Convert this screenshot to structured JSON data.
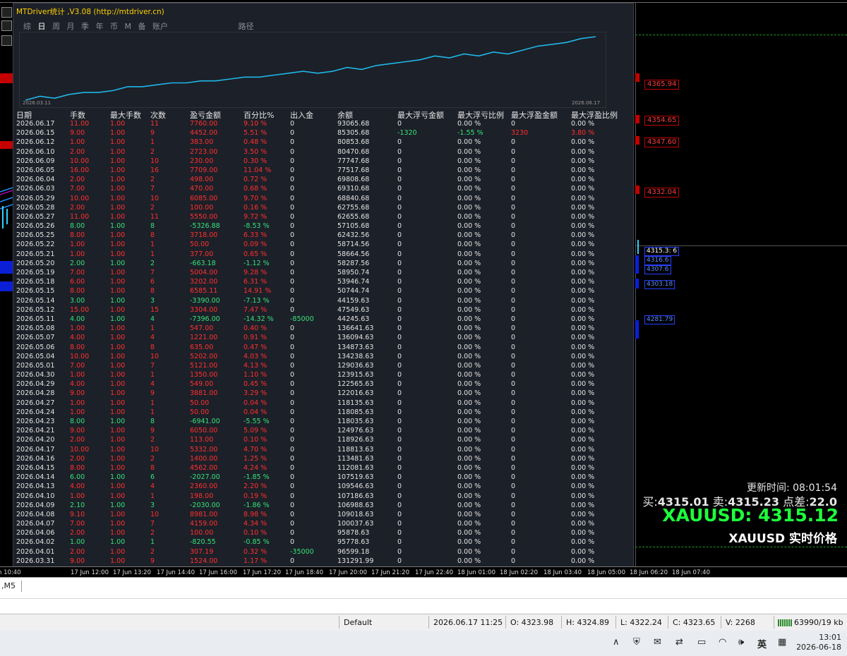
{
  "panel": {
    "title": "MTDriver统计 ,V3.08 (http://mtdriver.cn)",
    "menu": [
      "综",
      "日",
      "周",
      "月",
      "季",
      "年",
      "币",
      "M",
      "备",
      "账户",
      "路径"
    ],
    "curve_start": "2026.03.11",
    "curve_end": "2026.06.17",
    "headers": [
      "日期",
      "手数",
      "最大手数",
      "次数",
      "盈亏金额",
      "百分比%",
      "出入金",
      "余额",
      "最大浮亏金额",
      "最大浮亏比例",
      "最大浮盈金额",
      "最大浮盈比例"
    ],
    "rows": [
      [
        "2026.06.17",
        "11.00",
        "1.00",
        "11",
        "7760.00",
        "9.10 %",
        "0",
        "93065.68",
        "0",
        "0.00 %",
        "0",
        "0.00 %"
      ],
      [
        "2026.06.15",
        "9.00",
        "1.00",
        "9",
        "4452.00",
        "5.51 %",
        "0",
        "85305.68",
        "-1320",
        "-1.55 %",
        "3230",
        "3.80 %"
      ],
      [
        "2026.06.12",
        "1.00",
        "1.00",
        "1",
        "383.00",
        "0.48 %",
        "0",
        "80853.68",
        "0",
        "0.00 %",
        "0",
        "0.00 %"
      ],
      [
        "2026.06.10",
        "2.00",
        "1.00",
        "2",
        "2723.00",
        "3.50 %",
        "0",
        "80470.68",
        "0",
        "0.00 %",
        "0",
        "0.00 %"
      ],
      [
        "2026.06.09",
        "10.00",
        "1.00",
        "10",
        "230.00",
        "0.30 %",
        "0",
        "77747.68",
        "0",
        "0.00 %",
        "0",
        "0.00 %"
      ],
      [
        "2026.06.05",
        "16.00",
        "1.00",
        "16",
        "7709.00",
        "11.04 %",
        "0",
        "77517.68",
        "0",
        "0.00 %",
        "0",
        "0.00 %"
      ],
      [
        "2026.06.04",
        "2.00",
        "1.00",
        "2",
        "498.00",
        "0.72 %",
        "0",
        "69808.68",
        "0",
        "0.00 %",
        "0",
        "0.00 %"
      ],
      [
        "2026.06.03",
        "7.00",
        "1.00",
        "7",
        "470.00",
        "0.68 %",
        "0",
        "69310.68",
        "0",
        "0.00 %",
        "0",
        "0.00 %"
      ],
      [
        "2026.05.29",
        "10.00",
        "1.00",
        "10",
        "6085.00",
        "9.70 %",
        "0",
        "68840.68",
        "0",
        "0.00 %",
        "0",
        "0.00 %"
      ],
      [
        "2026.05.28",
        "2.00",
        "1.00",
        "2",
        "100.00",
        "0.16 %",
        "0",
        "62755.68",
        "0",
        "0.00 %",
        "0",
        "0.00 %"
      ],
      [
        "2026.05.27",
        "11.00",
        "1.00",
        "11",
        "5550.00",
        "9.72 %",
        "0",
        "62655.68",
        "0",
        "0.00 %",
        "0",
        "0.00 %"
      ],
      [
        "2026.05.26",
        "8.00",
        "1.00",
        "8",
        "-5326.88",
        "-8.53 %",
        "0",
        "57105.68",
        "0",
        "0.00 %",
        "0",
        "0.00 %"
      ],
      [
        "2026.05.25",
        "8.00",
        "1.00",
        "8",
        "3718.00",
        "6.33 %",
        "0",
        "62432.56",
        "0",
        "0.00 %",
        "0",
        "0.00 %"
      ],
      [
        "2026.05.22",
        "1.00",
        "1.00",
        "1",
        "50.00",
        "0.09 %",
        "0",
        "58714.56",
        "0",
        "0.00 %",
        "0",
        "0.00 %"
      ],
      [
        "2026.05.21",
        "1.00",
        "1.00",
        "1",
        "377.00",
        "0.65 %",
        "0",
        "58664.56",
        "0",
        "0.00 %",
        "0",
        "0.00 %"
      ],
      [
        "2026.05.20",
        "2.00",
        "1.00",
        "2",
        "-663.18",
        "-1.12 %",
        "0",
        "58287.56",
        "0",
        "0.00 %",
        "0",
        "0.00 %"
      ],
      [
        "2026.05.19",
        "7.00",
        "1.00",
        "7",
        "5004.00",
        "9.28 %",
        "0",
        "58950.74",
        "0",
        "0.00 %",
        "0",
        "0.00 %"
      ],
      [
        "2026.05.18",
        "6.00",
        "1.00",
        "6",
        "3202.00",
        "6.31 %",
        "0",
        "53946.74",
        "0",
        "0.00 %",
        "0",
        "0.00 %"
      ],
      [
        "2026.05.15",
        "8.00",
        "1.00",
        "8",
        "6585.11",
        "14.91 %",
        "0",
        "50744.74",
        "0",
        "0.00 %",
        "0",
        "0.00 %"
      ],
      [
        "2026.05.14",
        "3.00",
        "1.00",
        "3",
        "-3390.00",
        "-7.13 %",
        "0",
        "44159.63",
        "0",
        "0.00 %",
        "0",
        "0.00 %"
      ],
      [
        "2026.05.12",
        "15.00",
        "1.00",
        "15",
        "3304.00",
        "7.47 %",
        "0",
        "47549.63",
        "0",
        "0.00 %",
        "0",
        "0.00 %"
      ],
      [
        "2026.05.11",
        "4.00",
        "1.00",
        "4",
        "-7396.00",
        "-14.32 %",
        "-85000",
        "44245.63",
        "0",
        "0.00 %",
        "0",
        "0.00 %"
      ],
      [
        "2026.05.08",
        "1.00",
        "1.00",
        "1",
        "547.00",
        "0.40 %",
        "0",
        "136641.63",
        "0",
        "0.00 %",
        "0",
        "0.00 %"
      ],
      [
        "2026.05.07",
        "4.00",
        "1.00",
        "4",
        "1221.00",
        "0.91 %",
        "0",
        "136094.63",
        "0",
        "0.00 %",
        "0",
        "0.00 %"
      ],
      [
        "2026.05.06",
        "8.00",
        "1.00",
        "8",
        "635.00",
        "0.47 %",
        "0",
        "134873.63",
        "0",
        "0.00 %",
        "0",
        "0.00 %"
      ],
      [
        "2026.05.04",
        "10.00",
        "1.00",
        "10",
        "5202.00",
        "4.03 %",
        "0",
        "134238.63",
        "0",
        "0.00 %",
        "0",
        "0.00 %"
      ],
      [
        "2026.05.01",
        "7.00",
        "1.00",
        "7",
        "5121.00",
        "4.13 %",
        "0",
        "129036.63",
        "0",
        "0.00 %",
        "0",
        "0.00 %"
      ],
      [
        "2026.04.30",
        "1.00",
        "1.00",
        "1",
        "1350.00",
        "1.10 %",
        "0",
        "123915.63",
        "0",
        "0.00 %",
        "0",
        "0.00 %"
      ],
      [
        "2026.04.29",
        "4.00",
        "1.00",
        "4",
        "549.00",
        "0.45 %",
        "0",
        "122565.63",
        "0",
        "0.00 %",
        "0",
        "0.00 %"
      ],
      [
        "2026.04.28",
        "9.00",
        "1.00",
        "9",
        "3881.00",
        "3.29 %",
        "0",
        "122016.63",
        "0",
        "0.00 %",
        "0",
        "0.00 %"
      ],
      [
        "2026.04.27",
        "1.00",
        "1.00",
        "1",
        "50.00",
        "0.04 %",
        "0",
        "118135.63",
        "0",
        "0.00 %",
        "0",
        "0.00 %"
      ],
      [
        "2026.04.24",
        "1.00",
        "1.00",
        "1",
        "50.00",
        "0.04 %",
        "0",
        "118085.63",
        "0",
        "0.00 %",
        "0",
        "0.00 %"
      ],
      [
        "2026.04.23",
        "8.00",
        "1.00",
        "8",
        "-6941.00",
        "-5.55 %",
        "0",
        "118035.63",
        "0",
        "0.00 %",
        "0",
        "0.00 %"
      ],
      [
        "2026.04.21",
        "9.00",
        "1.00",
        "9",
        "6050.00",
        "5.09 %",
        "0",
        "124976.63",
        "0",
        "0.00 %",
        "0",
        "0.00 %"
      ],
      [
        "2026.04.20",
        "2.00",
        "1.00",
        "2",
        "113.00",
        "0.10 %",
        "0",
        "118926.63",
        "0",
        "0.00 %",
        "0",
        "0.00 %"
      ],
      [
        "2026.04.17",
        "10.00",
        "1.00",
        "10",
        "5332.00",
        "4.70 %",
        "0",
        "118813.63",
        "0",
        "0.00 %",
        "0",
        "0.00 %"
      ],
      [
        "2026.04.16",
        "2.00",
        "1.00",
        "2",
        "1400.00",
        "1.25 %",
        "0",
        "113481.63",
        "0",
        "0.00 %",
        "0",
        "0.00 %"
      ],
      [
        "2026.04.15",
        "8.00",
        "1.00",
        "8",
        "4562.00",
        "4.24 %",
        "0",
        "112081.63",
        "0",
        "0.00 %",
        "0",
        "0.00 %"
      ],
      [
        "2026.04.14",
        "6.00",
        "1.00",
        "6",
        "-2027.00",
        "-1.85 %",
        "0",
        "107519.63",
        "0",
        "0.00 %",
        "0",
        "0.00 %"
      ],
      [
        "2026.04.13",
        "4.00",
        "1.00",
        "4",
        "2360.00",
        "2.20 %",
        "0",
        "109546.63",
        "0",
        "0.00 %",
        "0",
        "0.00 %"
      ],
      [
        "2026.04.10",
        "1.00",
        "1.00",
        "1",
        "198.00",
        "0.19 %",
        "0",
        "107186.63",
        "0",
        "0.00 %",
        "0",
        "0.00 %"
      ],
      [
        "2026.04.09",
        "2.10",
        "1.00",
        "3",
        "-2030.00",
        "-1.86 %",
        "0",
        "106988.63",
        "0",
        "0.00 %",
        "0",
        "0.00 %"
      ],
      [
        "2026.04.08",
        "9.10",
        "1.00",
        "10",
        "8981.00",
        "8.98 %",
        "0",
        "109018.63",
        "0",
        "0.00 %",
        "0",
        "0.00 %"
      ],
      [
        "2026.04.07",
        "7.00",
        "1.00",
        "7",
        "4159.00",
        "4.34 %",
        "0",
        "100037.63",
        "0",
        "0.00 %",
        "0",
        "0.00 %"
      ],
      [
        "2026.04.06",
        "2.00",
        "1.00",
        "2",
        "100.00",
        "0.10 %",
        "0",
        "95878.63",
        "0",
        "0.00 %",
        "0",
        "0.00 %"
      ],
      [
        "2026.04.02",
        "1.00",
        "1.00",
        "1",
        "-820.55",
        "-0.85 %",
        "0",
        "95778.63",
        "0",
        "0.00 %",
        "0",
        "0.00 %"
      ],
      [
        "2026.04.01",
        "2.00",
        "1.00",
        "2",
        "307.19",
        "0.32 %",
        "-35000",
        "96599.18",
        "0",
        "0.00 %",
        "0",
        "0.00 %"
      ],
      [
        "2026.03.31",
        "9.00",
        "1.00",
        "9",
        "1524.00",
        "1.17 %",
        "0",
        "131291.99",
        "0",
        "0.00 %",
        "0",
        "0.00 %"
      ]
    ]
  },
  "price_labels": {
    "p1": "4365.94",
    "p2": "4354.65",
    "p3": "4347.60",
    "p4": "4332.04"
  },
  "price_tags": [
    "4315.3: 6",
    "4316.6",
    "4307.6",
    "4303.18",
    "4281.79"
  ],
  "time_axis": [
    "n 10:40",
    "17 Jun 12:00",
    "17 Jun 13:20",
    "17 Jun 14:40",
    "17 Jun 16:00",
    "17 Jun 17:20",
    "17 Jun 18:40",
    "17 Jun 20:00",
    "17 Jun 21:20",
    "17 Jun 22:40",
    "18 Jun 01:00",
    "18 Jun 02:20",
    "18 Jun 03:40",
    "18 Jun 05:00",
    "18 Jun 06:20",
    "18 Jun 07:40"
  ],
  "quote": {
    "update": "更新时间: 08:01:54",
    "buy_label": "买:",
    "buy": "4315.01",
    "sell_label": "卖:",
    "sell": "4315.23",
    "spread_label": "点差:",
    "spread": "22.0",
    "big": "XAUUSD: 4315.12",
    "realtime": "XAUUSD 实时价格"
  },
  "tab": {
    "label": ",M5"
  },
  "status": {
    "profile": "Default",
    "datetime": "2026.06.17 11:25",
    "open": "O: 4323.98",
    "high": "H: 4324.89",
    "low": "L: 4322.24",
    "close": "C: 4323.65",
    "volume": "V: 2268",
    "traffic": "63990/19 kb"
  },
  "taskbar": {
    "ime": "英",
    "time": "13:01",
    "date": "2026-06-18"
  },
  "colors": {
    "profit": "#ff3030",
    "loss": "#35e27a",
    "curve": "#1fb6e8",
    "quote_green": "#1eff3c"
  },
  "curve_points": [
    0,
    2,
    1,
    3,
    4,
    4,
    5,
    7,
    7,
    8,
    9,
    9,
    10,
    10,
    11,
    12,
    12,
    13,
    14,
    15,
    14,
    15,
    17,
    16,
    18,
    19,
    20,
    21,
    23,
    22,
    24,
    23,
    25,
    24,
    26,
    28,
    29,
    30,
    32,
    33
  ]
}
